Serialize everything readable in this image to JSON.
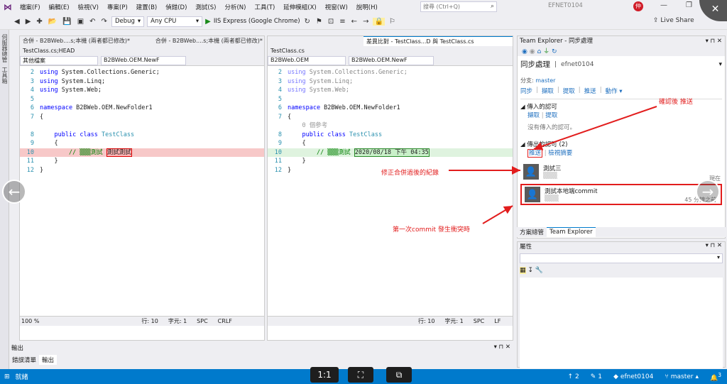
{
  "menubar": {
    "logo": "⋈",
    "items": [
      "檔案(F)",
      "編輯(E)",
      "檢視(V)",
      "專案(P)",
      "建置(B)",
      "偵錯(D)",
      "測試(S)",
      "分析(N)",
      "工具(T)",
      "延伸模組(X)",
      "視窗(W)",
      "說明(H)"
    ],
    "search_placeholder": "搜尋 (Ctrl+Q)",
    "solution_name": "EFNET0104",
    "avatar_letter": "仲",
    "window_controls": [
      "—",
      "❐",
      "✕"
    ]
  },
  "toolbar": {
    "config": "Debug",
    "platform": "Any CPU",
    "run_target": "IIS Express (Google Chrome)",
    "live_share": "Live Share"
  },
  "left_strip": {
    "items": [
      "伺服器總管",
      "工具箱"
    ]
  },
  "left_pane": {
    "tabs": [
      "合併 - B2BWeb....s;本機 (兩者都已修改)*",
      "合併 - B2BWeb....s;本機 (兩者都已修改)*"
    ],
    "file_label": "TestClass.cs;HEAD",
    "project_dropdown": "其他檔案",
    "class_dropdown": "B2BWeb.OEM.NewF",
    "zoom": "100 %",
    "status": [
      "行: 10",
      "字元: 1",
      "SPC",
      "CRLF"
    ],
    "lines": [
      {
        "n": "2",
        "html": "<span class='kw'>using</span> System.Collections.Generic;"
      },
      {
        "n": "3",
        "html": "<span class='kw'>using</span> System.Linq;"
      },
      {
        "n": "4",
        "html": "<span class='kw'>using</span> System.Web;"
      },
      {
        "n": "5",
        "html": ""
      },
      {
        "n": "6",
        "html": "<span class='kw'>namespace</span> B2BWeb.OEM.NewFolder1"
      },
      {
        "n": "7",
        "html": "{"
      },
      {
        "n": "",
        "html": ""
      },
      {
        "n": "8",
        "html": "    <span class='kw'>public</span> <span class='kw'>class</span> <span class='ty'>TestClass</span>"
      },
      {
        "n": "9",
        "html": "    {"
      },
      {
        "n": "10",
        "html": "        <span class='cm'>// ▒▒▒測試</span> <span style='border:1px solid #d00;background:#ffb4b4'>測試測試</span>",
        "hl": "#f7c8c8"
      },
      {
        "n": "11",
        "html": "    }"
      },
      {
        "n": "12",
        "html": "}"
      }
    ]
  },
  "right_pane": {
    "tab_title": "差異比對 - TestClass...D 與 TestClass.cs",
    "file_label": "TestClass.cs",
    "project_dropdown": "B2BWeb.OEM",
    "class_dropdown": "B2BWeb.OEM.NewF",
    "status": [
      "行: 10",
      "字元: 1",
      "SPC",
      "LF"
    ],
    "lines": [
      {
        "n": "2",
        "html": "<span class='kw'>using</span> System.Collections.Generic;",
        "dim": true
      },
      {
        "n": "3",
        "html": "<span class='kw'>using</span> System.Linq;",
        "dim": true
      },
      {
        "n": "4",
        "html": "<span class='kw'>using</span> System.Web;",
        "dim": true
      },
      {
        "n": "5",
        "html": ""
      },
      {
        "n": "6",
        "html": "<span class='kw'>namespace</span> B2BWeb.OEM.NewFolder1"
      },
      {
        "n": "7",
        "html": "{"
      },
      {
        "n": "",
        "html": "    <span class='gray'>0 個參考</span>"
      },
      {
        "n": "8",
        "html": "    <span class='kw'>public</span> <span class='kw'>class</span> <span class='ty'>TestClass</span>"
      },
      {
        "n": "9",
        "html": "    {"
      },
      {
        "n": "10",
        "html": "        <span class='cm'>// ▒▒▒測試</span> <span style='border:1px solid #2a8a2a;background:#c9f0c9'>2020/08/18 下午 04:35</span>",
        "hl": "#dff3df"
      },
      {
        "n": "11",
        "html": "    }"
      },
      {
        "n": "12",
        "html": "}"
      }
    ]
  },
  "team_explorer": {
    "title": "Team Explorer - 同步處理",
    "section_title": "同步處理",
    "repo": "efnet0104",
    "branch_label": "分支: ",
    "branch": "master",
    "actions": [
      "同步",
      "擷取",
      "提取",
      "推送",
      "動作 ▾"
    ],
    "incoming_title": "傳入的認可",
    "incoming_links": [
      "擷取",
      "提取"
    ],
    "incoming_empty": "沒有傳入的認可。",
    "outgoing_title": "傳出的認可 (2)",
    "outgoing_links": [
      "推送",
      "檢視摘要"
    ],
    "commits": [
      {
        "msg": "測試三",
        "author": "▒▒▒",
        "time": "現在"
      },
      {
        "msg": "測試本地端commit",
        "author": "▒▒▒",
        "time": "45 分鐘之前"
      }
    ],
    "annotation_push": "確認後 推送",
    "annotation_fix": "修正合併過後的紀錄",
    "annotation_first": "第一次commit 發生衝突時",
    "tabs": [
      "方案總管",
      "Team Explorer"
    ]
  },
  "properties": {
    "title": "屬性"
  },
  "output": {
    "title": "輸出",
    "tabs": [
      "錯誤清單",
      "輸出"
    ]
  },
  "statusbar": {
    "ready": "就緒",
    "up": "2",
    "pencil": "1",
    "repo": "efnet0104",
    "branch": "master",
    "notif": "3"
  },
  "overlay": {
    "ratio": "1:1"
  },
  "colors": {
    "accent": "#007acc",
    "annotation": "#e21d1d"
  }
}
